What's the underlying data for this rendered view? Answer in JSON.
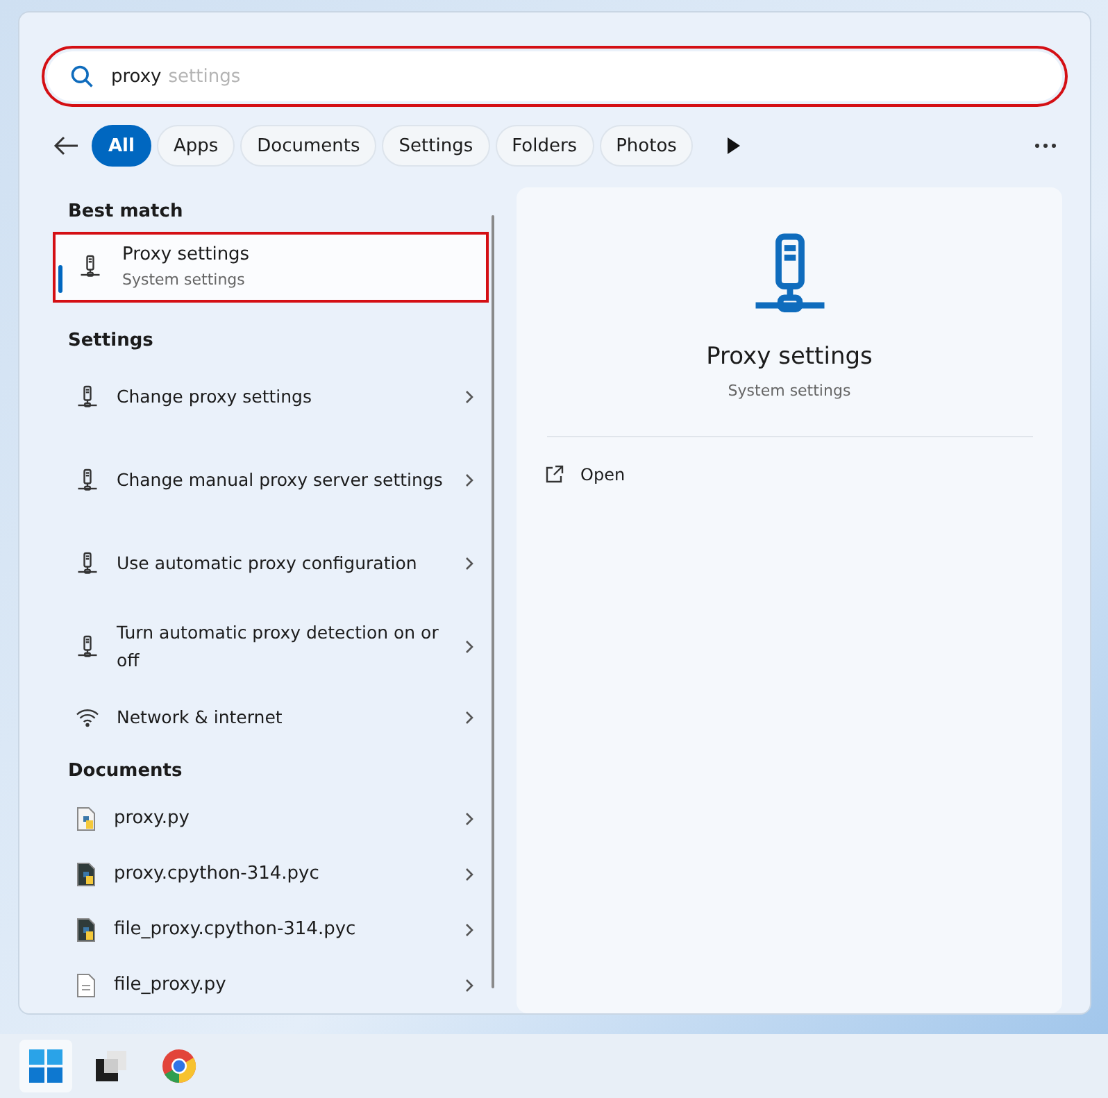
{
  "search": {
    "value": "proxy",
    "suggestion": "settings",
    "highlighted": true
  },
  "filters": [
    {
      "label": "All",
      "selected": true
    },
    {
      "label": "Apps",
      "selected": false
    },
    {
      "label": "Documents",
      "selected": false
    },
    {
      "label": "Settings",
      "selected": false
    },
    {
      "label": "Folders",
      "selected": false
    },
    {
      "label": "Photos",
      "selected": false
    }
  ],
  "best_match": {
    "heading": "Best match",
    "title": "Proxy settings",
    "subtitle": "System settings",
    "selected": true,
    "highlighted": true
  },
  "settings": {
    "heading": "Settings",
    "items": [
      {
        "label": "Change proxy settings",
        "kind": "proxy"
      },
      {
        "label": "Change manual proxy server settings",
        "kind": "proxy"
      },
      {
        "label": "Use automatic proxy configuration",
        "kind": "proxy"
      },
      {
        "label": "Turn automatic proxy detection on or off",
        "kind": "proxy"
      },
      {
        "label": "Network & internet",
        "kind": "wifi"
      }
    ]
  },
  "documents": {
    "heading": "Documents",
    "items": [
      {
        "label": "proxy.py",
        "kind": "py"
      },
      {
        "label": "proxy.cpython-314.pyc",
        "kind": "pyc"
      },
      {
        "label": "file_proxy.cpython-314.pyc",
        "kind": "pyc"
      },
      {
        "label": "file_proxy.py",
        "kind": "doc"
      }
    ]
  },
  "detail": {
    "title": "Proxy settings",
    "subtitle": "System settings",
    "actions": [
      "Open"
    ]
  }
}
